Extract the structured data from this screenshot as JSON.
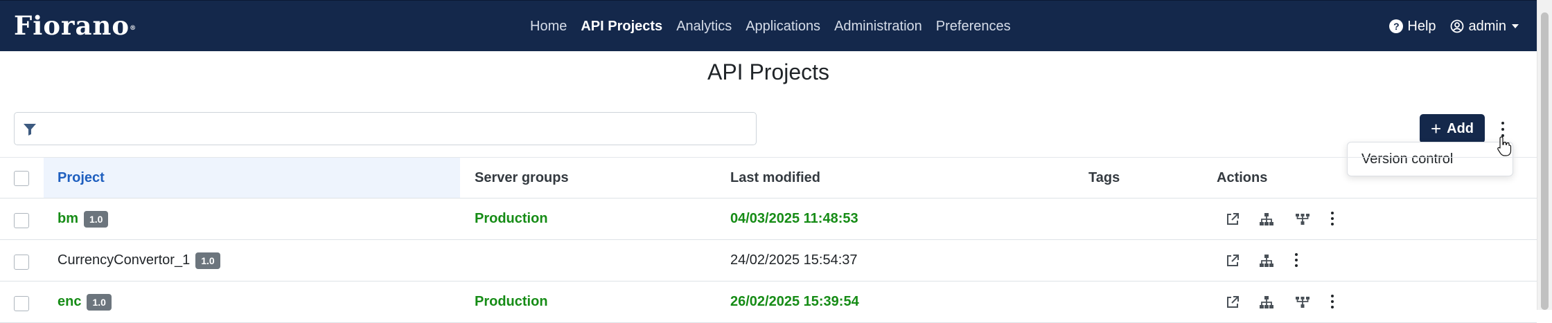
{
  "navbar": {
    "logo": "Fiorano",
    "logo_mark": "®",
    "links": [
      "Home",
      "API Projects",
      "Analytics",
      "Applications",
      "Administration",
      "Preferences"
    ],
    "help_label": "Help",
    "user_label": "admin"
  },
  "page": {
    "title": "API Projects"
  },
  "filter": {
    "placeholder": ""
  },
  "toolbar": {
    "add_label": "Add"
  },
  "dropdown": {
    "version_control": "Version control"
  },
  "table": {
    "columns": [
      "Project",
      "Server groups",
      "Last modified",
      "Tags",
      "Actions"
    ],
    "rows": [
      {
        "project": "bm",
        "version": "1.0",
        "server_group": "Production",
        "last_modified": "04/03/2025 11:48:53",
        "tags": ""
      },
      {
        "project": "CurrencyConvertor_1",
        "version": "1.0",
        "server_group": "",
        "last_modified": "24/02/2025 15:54:37",
        "tags": ""
      },
      {
        "project": "enc",
        "version": "1.0",
        "server_group": "Production",
        "last_modified": "26/02/2025 15:39:54",
        "tags": ""
      }
    ]
  },
  "colors": {
    "navbar": "#14284b",
    "accent_green": "#168c16",
    "header_blue": "#1f5fbf",
    "badge": "#6c757d"
  }
}
